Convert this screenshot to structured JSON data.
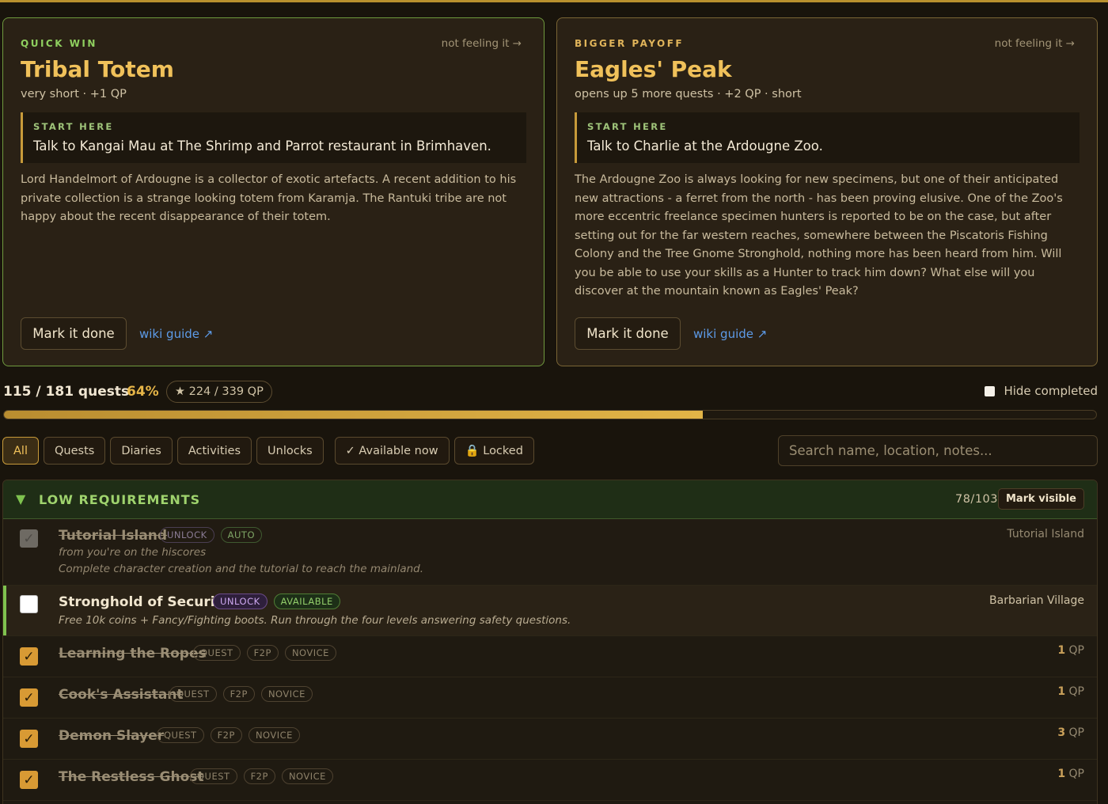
{
  "cards": [
    {
      "kicker": "QUICK WIN",
      "skip": "not feeling it →",
      "title": "Tribal Totem",
      "meta": "very short · +1 QP",
      "start_label": "START HERE",
      "start_text": "Talk to Kangai Mau at The Shrimp and Parrot restaurant in Brimhaven.",
      "description": "Lord Handelmort of Ardougne is a collector of exotic artefacts. A recent addition to his private collection is a strange looking totem from Karamja. The Rantuki tribe are not happy about the recent disappearance of their totem.",
      "done_label": "Mark it done",
      "wiki_label": "wiki guide ↗"
    },
    {
      "kicker": "BIGGER PAYOFF",
      "skip": "not feeling it →",
      "title": "Eagles' Peak",
      "meta": "opens up 5 more quests · +2 QP · short",
      "start_label": "START HERE",
      "start_text": "Talk to Charlie at the Ardougne Zoo.",
      "description": "The Ardougne Zoo is always looking for new specimens, but one of their anticipated new attractions - a ferret from the north - has been proving elusive. One of the Zoo's more eccentric freelance specimen hunters is reported to be on the case, but after setting out for the far western reaches, somewhere between the Piscatoris Fishing Colony and the Tree Gnome Stronghold, nothing more has been heard from him. Will you be able to use your skills as a Hunter to track him down? What else will you discover at the mountain known as Eagles' Peak?",
      "done_label": "Mark it done",
      "wiki_label": "wiki guide ↗"
    }
  ],
  "progress": {
    "count_text": "115 / 181 quests",
    "percent_text": "64%",
    "qp_text": "★ 224 / 339 QP",
    "fill_fraction": 0.64,
    "hide_completed_label": "Hide completed"
  },
  "filters": {
    "all": "All",
    "quests": "Quests",
    "diaries": "Diaries",
    "activities": "Activities",
    "unlocks": "Unlocks",
    "available": "✓ Available now",
    "locked": "🔒 Locked",
    "search_placeholder": "Search name, location, notes..."
  },
  "section": {
    "caret": "▼",
    "title": "LOW REQUIREMENTS",
    "count": "78/103",
    "mark_visible": "Mark visible"
  },
  "rows": [
    {
      "name": "Tutorial Island",
      "tags": [
        "UNLOCK",
        "AUTO"
      ],
      "sub1": "from you're on the hiscores",
      "sub2": "Complete character creation and the tutorial to reach the mainland.",
      "right": "Tutorial Island"
    },
    {
      "name": "Stronghold of Security",
      "tags": [
        "UNLOCK",
        "AVAILABLE"
      ],
      "sub1": "Free 10k coins + Fancy/Fighting boots. Run through the four levels answering safety questions.",
      "right": "Barbarian Village"
    },
    {
      "name": "Learning the Ropes",
      "tags": [
        "QUEST",
        "F2P",
        "NOVICE"
      ],
      "qp_num": "1",
      "qp_unit": " QP"
    },
    {
      "name": "Cook's Assistant",
      "tags": [
        "QUEST",
        "F2P",
        "NOVICE"
      ],
      "qp_num": "1",
      "qp_unit": " QP"
    },
    {
      "name": "Demon Slayer",
      "tags": [
        "QUEST",
        "F2P",
        "NOVICE"
      ],
      "qp_num": "3",
      "qp_unit": " QP"
    },
    {
      "name": "The Restless Ghost",
      "tags": [
        "QUEST",
        "F2P",
        "NOVICE"
      ],
      "qp_num": "1",
      "qp_unit": " QP"
    }
  ],
  "colors": {
    "accent_gold": "#e6b548",
    "accent_green": "#7fc24f",
    "background": "#19140c",
    "card": "#2a2115"
  }
}
